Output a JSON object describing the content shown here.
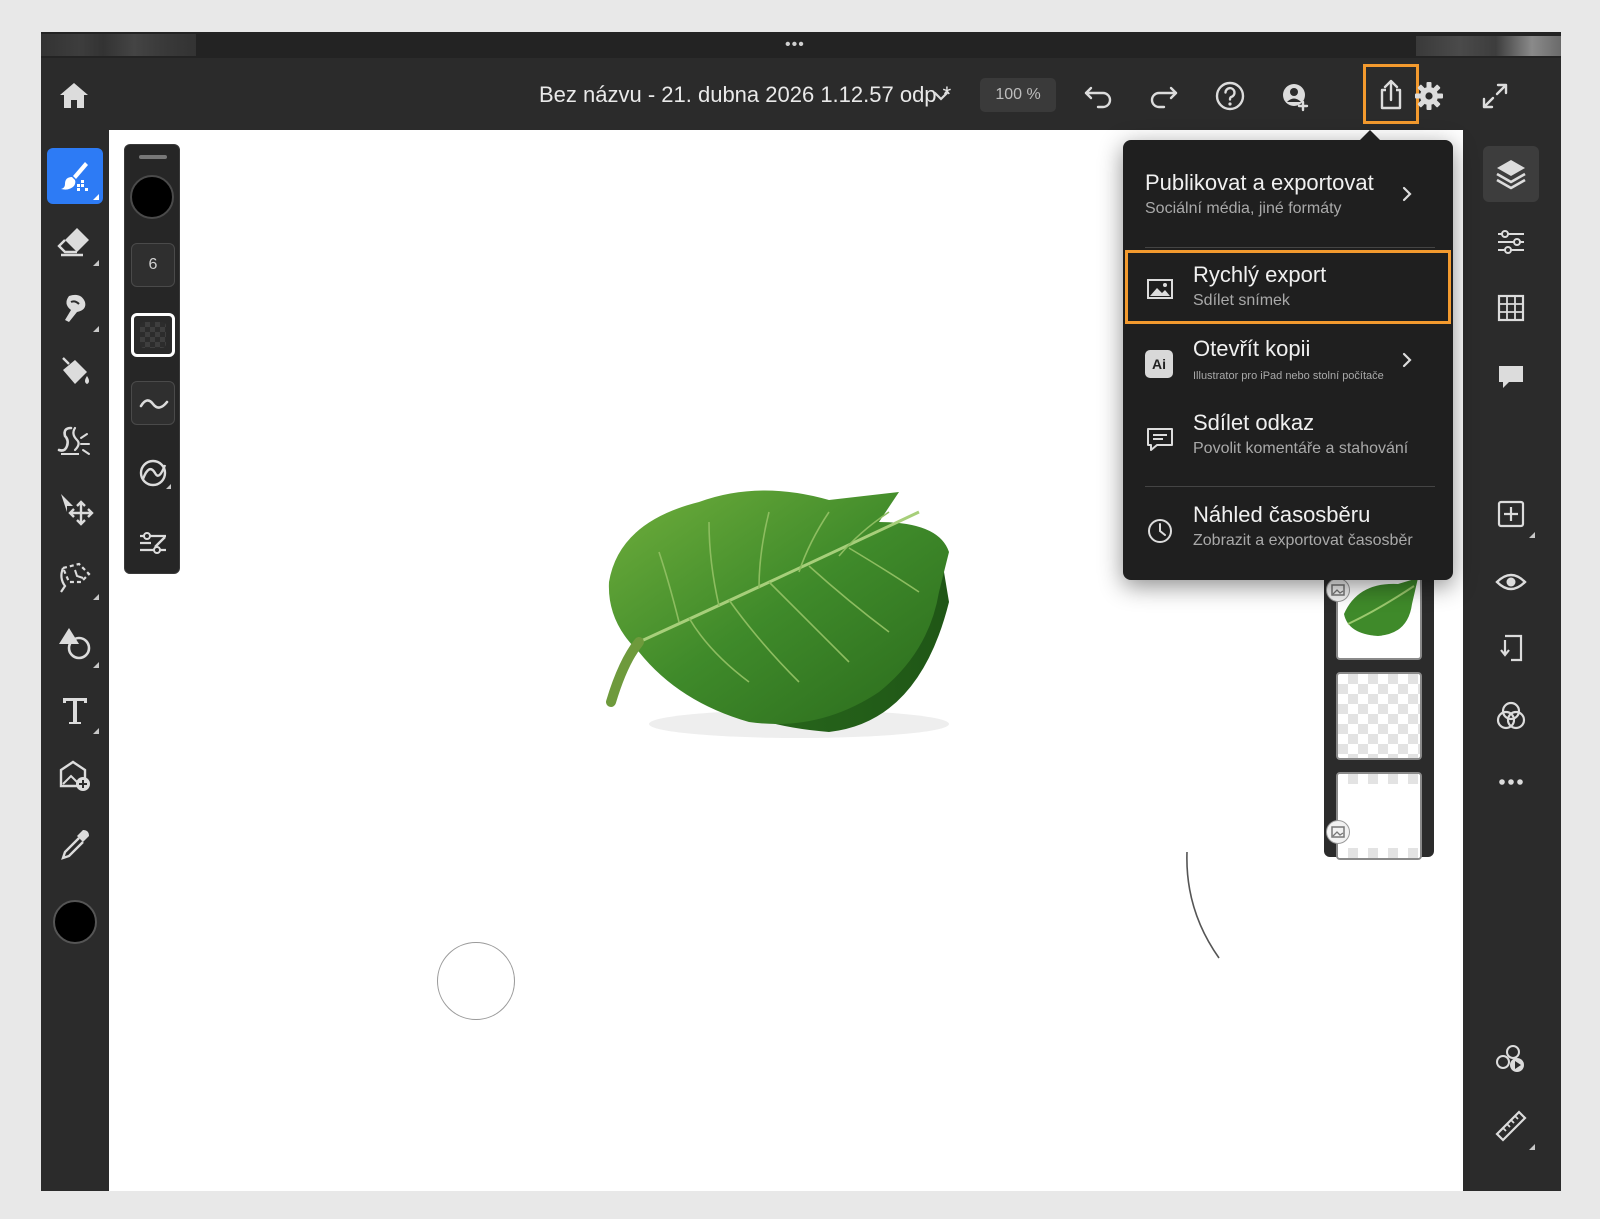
{
  "topbar": {
    "document_title": "Bez názvu - 21. dubna 2026 1.12.57 odp *",
    "zoom_level": "100 %"
  },
  "brush_panel": {
    "size_value": "6"
  },
  "export_menu": {
    "items": [
      {
        "title": "Publikovat a exportovat",
        "subtitle": "Sociální média, jiné formáty"
      },
      {
        "title": "Rychlý export",
        "subtitle": "Sdílet snímek"
      },
      {
        "title": "Otevřít kopii",
        "subtitle": "Illustrator pro iPad nebo stolní počítače",
        "badge": "Ai"
      },
      {
        "title": "Sdílet odkaz",
        "subtitle": "Povolit komentáře a stahování"
      },
      {
        "title": "Náhled časosběru",
        "subtitle": "Zobrazit a exportovat časosběr"
      }
    ]
  },
  "colors": {
    "accent_highlight": "#f39a2e",
    "active_tool": "#2d7bf5",
    "chrome": "#2b2b2b",
    "menu_bg": "#1f1f1f",
    "foreground_color": "#000000"
  },
  "icons": {
    "topbar": [
      "home-icon",
      "chevron-down-icon",
      "undo-icon",
      "redo-icon",
      "help-icon",
      "invite-user-icon",
      "share-export-icon",
      "settings-gear-icon",
      "fullscreen-icon"
    ],
    "left_rail": [
      "brush-icon",
      "eraser-icon",
      "smudge-icon",
      "fill-bucket-icon",
      "liquify-icon",
      "move-transform-icon",
      "lasso-select-icon",
      "shape-icon",
      "text-icon",
      "place-image-icon",
      "eyedropper-icon"
    ],
    "right_rail": [
      "layers-icon",
      "adjustments-icon",
      "grid-icon",
      "comments-icon",
      "add-layer-icon",
      "visibility-eye-icon",
      "merge-down-icon",
      "blend-mode-icon",
      "more-dots-icon",
      "timelapse-icon",
      "ruler-icon"
    ],
    "export_menu": [
      "chevron-right-icon",
      "image-icon",
      "illustrator-icon",
      "comment-share-icon",
      "clock-icon"
    ]
  }
}
